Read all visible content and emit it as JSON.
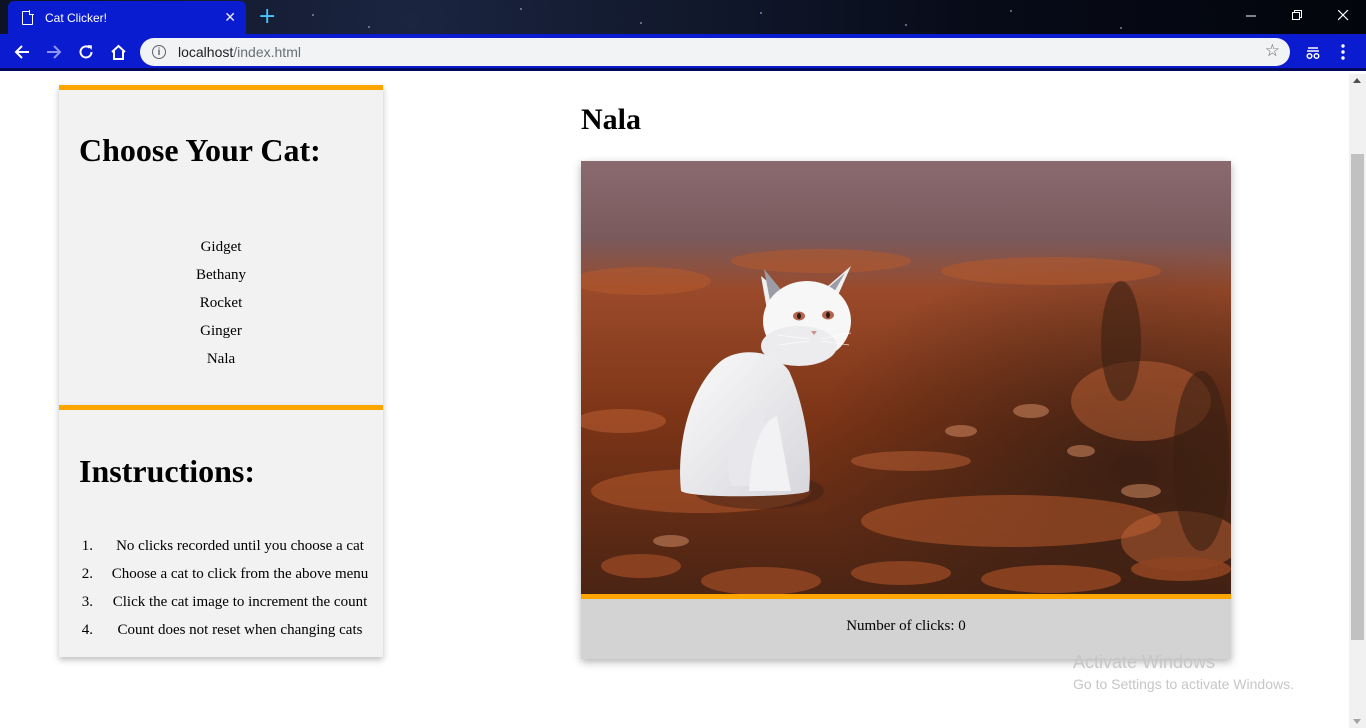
{
  "browser": {
    "tab_title": "Cat Clicker!",
    "tab_close": "✕",
    "new_tab": "+",
    "url_host": "localhost",
    "url_path": "/index.html",
    "icons": [
      "document-icon",
      "back-arrow-icon",
      "forward-arrow-icon",
      "reload-icon",
      "home-icon",
      "info-icon",
      "bookmark-star-icon",
      "extension-icon",
      "menu-kebab-icon",
      "minimize-icon",
      "restore-icon",
      "close-icon"
    ],
    "colors": {
      "tab": "#0a1ccf",
      "toolbar": "#0b1bd0",
      "new_tab": "#45c8ff"
    }
  },
  "menu": {
    "title": "Choose Your Cat:",
    "cats": [
      "Gidget",
      "Bethany",
      "Rocket",
      "Ginger",
      "Nala"
    ]
  },
  "instructions": {
    "title": "Instructions:",
    "steps": [
      {
        "num": "1.",
        "text": "No clicks recorded until you choose a cat"
      },
      {
        "num": "2.",
        "text": "Choose a cat to click from the above menu"
      },
      {
        "num": "3.",
        "text": "Click the cat image to increment the count"
      },
      {
        "num": "4.",
        "text": "Count does not reset when changing cats"
      }
    ]
  },
  "display": {
    "cat_name": "Nala",
    "clicks_label": "Number of clicks: 0"
  },
  "watermark": {
    "line1": "Activate Windows",
    "line2": "Go to Settings to activate Windows."
  },
  "colors": {
    "accent": "#ffa500",
    "panel_bg": "#f2f2f2",
    "counter_bg": "#d3d3d3"
  }
}
